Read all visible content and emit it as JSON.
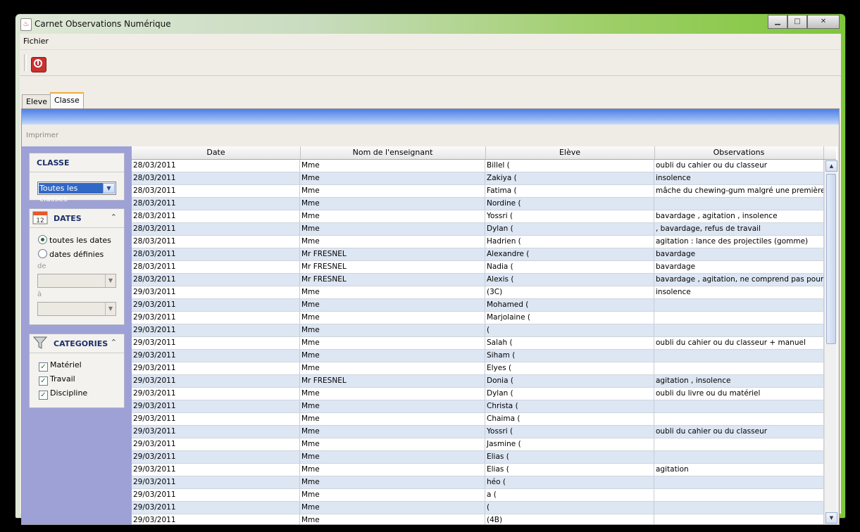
{
  "window": {
    "title": "Carnet Observations Numérique",
    "minimize": "▁",
    "maximize": "□",
    "close": "✕",
    "icon": "java-icon"
  },
  "menu": {
    "fichier": "Fichier"
  },
  "toolbar": {
    "power_icon": "power-icon",
    "accent": "#c93030"
  },
  "tabs": [
    {
      "label": "Eleve"
    },
    {
      "label": "Classe"
    }
  ],
  "panel": {
    "print_label": "Imprimer"
  },
  "sidebar": {
    "classe": {
      "title": "CLASSE",
      "selected": "Toutes les classes"
    },
    "dates": {
      "title": "DATES",
      "opt_all": "toutes les dates",
      "opt_defined": "dates définies",
      "from_label": "de",
      "to_label": "à",
      "icon": "calendar-icon",
      "calendar_day": "12"
    },
    "categories": {
      "title": "CATEGORIES",
      "icon": "funnel-icon",
      "items": [
        "Matériel",
        "Travail",
        "Discipline"
      ]
    }
  },
  "table": {
    "headers": [
      "Date",
      "Nom de l'enseignant",
      "Elève",
      "Observations"
    ],
    "rows": [
      [
        "28/03/2011",
        "Mme",
        "Billel (",
        "oubli du cahier ou du classeur"
      ],
      [
        "28/03/2011",
        "Mme",
        "Zakiya (",
        "insolence"
      ],
      [
        "28/03/2011",
        "Mme",
        "Fatima (",
        "mâche du chewing-gum malgré une première r…"
      ],
      [
        "28/03/2011",
        "Mme",
        "Nordine (",
        ""
      ],
      [
        "28/03/2011",
        "Mme",
        "Yossri (",
        "bavardage , agitation , insolence"
      ],
      [
        "28/03/2011",
        "Mme",
        "Dylan (",
        ", bavardage, refus de travail"
      ],
      [
        "28/03/2011",
        "Mme",
        "Hadrien (",
        "agitation : lance des projectiles (gomme)"
      ],
      [
        "28/03/2011",
        "Mr FRESNEL",
        "Alexandre (",
        "bavardage"
      ],
      [
        "28/03/2011",
        "Mr FRESNEL",
        "Nadia (",
        "bavardage"
      ],
      [
        "28/03/2011",
        "Mr FRESNEL",
        "Alexis (",
        "bavardage , agitation, ne comprend pas pourq…"
      ],
      [
        "29/03/2011",
        "Mme",
        "(3C)",
        "insolence"
      ],
      [
        "29/03/2011",
        "Mme",
        "Mohamed (",
        ""
      ],
      [
        "29/03/2011",
        "Mme",
        "Marjolaine (",
        ""
      ],
      [
        "29/03/2011",
        "Mme",
        "(",
        ""
      ],
      [
        "29/03/2011",
        "Mme",
        "Salah (",
        "oubli du cahier ou du classeur + manuel"
      ],
      [
        "29/03/2011",
        "Mme",
        "Siham (",
        ""
      ],
      [
        "29/03/2011",
        "Mme",
        "Elyes (",
        ""
      ],
      [
        "29/03/2011",
        "Mr FRESNEL",
        "Donia (",
        "agitation , insolence"
      ],
      [
        "29/03/2011",
        "Mme",
        "Dylan (",
        "oubli du livre ou du matériel"
      ],
      [
        "29/03/2011",
        "Mme",
        "Christa (",
        ""
      ],
      [
        "29/03/2011",
        "Mme",
        "Chaima (",
        ""
      ],
      [
        "29/03/2011",
        "Mme",
        "Yossri (",
        "oubli du cahier ou du classeur"
      ],
      [
        "29/03/2011",
        "Mme",
        "Jasmine (",
        ""
      ],
      [
        "29/03/2011",
        "Mme",
        "Elias (",
        ""
      ],
      [
        "29/03/2011",
        "Mme",
        "Elias (",
        "agitation"
      ],
      [
        "29/03/2011",
        "Mme",
        "héo (",
        ""
      ],
      [
        "29/03/2011",
        "Mme",
        "a (",
        ""
      ],
      [
        "29/03/2011",
        "Mme",
        "(",
        ""
      ],
      [
        "29/03/2011",
        "Mme",
        "(4B)",
        ""
      ]
    ]
  }
}
